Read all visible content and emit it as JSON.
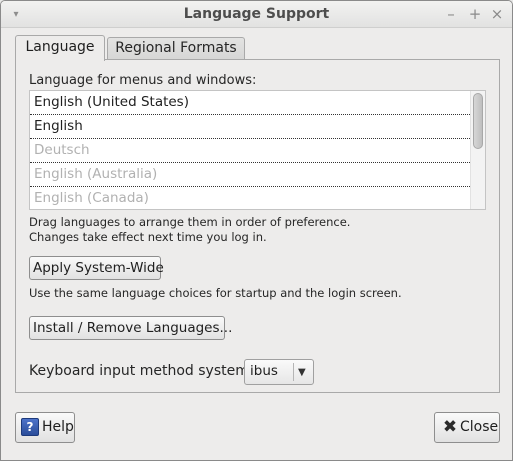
{
  "window": {
    "title": "Language Support",
    "controls": [
      "–",
      "+",
      "×"
    ]
  },
  "tabs": [
    {
      "label": "Language",
      "active": true
    },
    {
      "label": "Regional Formats",
      "active": false
    }
  ],
  "language_section": {
    "label": "Language for menus and windows:",
    "items": [
      {
        "label": "English (United States)",
        "active": true
      },
      {
        "label": "English",
        "active": true
      },
      {
        "label": "Deutsch",
        "active": false
      },
      {
        "label": "English (Australia)",
        "active": false
      },
      {
        "label": "English (Canada)",
        "active": false
      }
    ],
    "note_line1": "Drag languages to arrange them in order of preference.",
    "note_line2": "Changes take effect next time you log in."
  },
  "apply_button": "Apply System-Wide",
  "apply_note": "Use the same language choices for startup and the login screen.",
  "install_button": "Install / Remove Languages...",
  "keyboard": {
    "label": "Keyboard input method system:",
    "value": "ibus"
  },
  "footer": {
    "help_label": "Help",
    "close_label": "Close"
  },
  "icons": {
    "help": "help-icon",
    "close": "close-icon",
    "dropdown": "chevron-down-icon"
  }
}
